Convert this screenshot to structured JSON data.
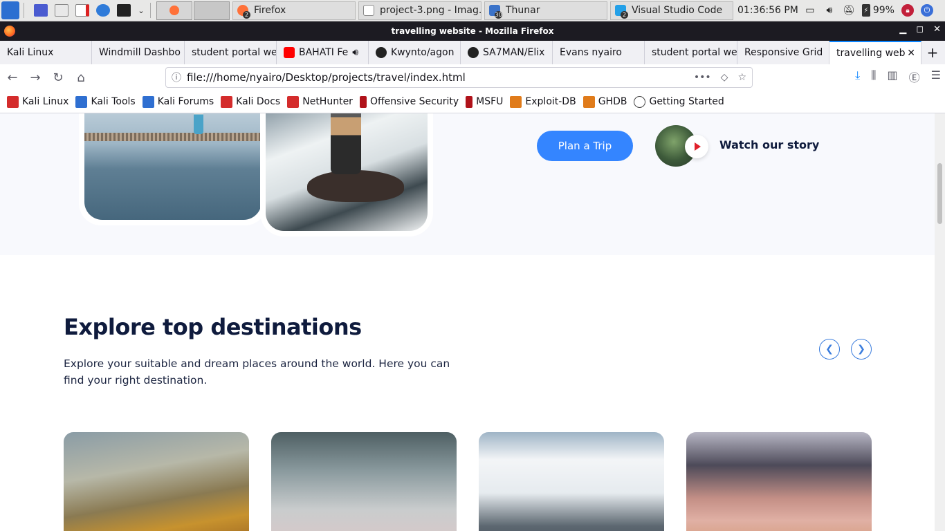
{
  "panel": {
    "tasks": [
      {
        "label": "Firefox",
        "badge": "2"
      },
      {
        "label": "project-3.png - Imag..."
      },
      {
        "label": "Thunar",
        "badge": "30"
      },
      {
        "label": "Visual Studio Code",
        "badge": "2"
      }
    ],
    "clock": "01:36:56 PM",
    "battery": "99%"
  },
  "window": {
    "title": "travelling website - Mozilla Firefox"
  },
  "tabs": [
    {
      "label": "Kali Linux"
    },
    {
      "label": "Windmill Dashbo"
    },
    {
      "label": "student portal we"
    },
    {
      "label": "BAHATI Fe"
    },
    {
      "label": "Kwynto/agon"
    },
    {
      "label": "SA7MAN/Elix"
    },
    {
      "label": "Evans nyairo"
    },
    {
      "label": "student portal we"
    },
    {
      "label": "Responsive Grid"
    },
    {
      "label": "travelling web"
    }
  ],
  "url": "file:///home/nyairo/Desktop/projects/travel/index.html",
  "bookmarks": [
    {
      "label": "Kali Linux",
      "color": "#d42c2c"
    },
    {
      "label": "Kali Tools",
      "color": "#2f6fd1"
    },
    {
      "label": "Kali Forums",
      "color": "#2f6fd1"
    },
    {
      "label": "Kali Docs",
      "color": "#d42c2c"
    },
    {
      "label": "NetHunter",
      "color": "#d42c2c"
    },
    {
      "label": "Offensive Security",
      "color": "#b0121a"
    },
    {
      "label": "MSFU",
      "color": "#b0121a"
    },
    {
      "label": "Exploit-DB",
      "color": "#e07b1a"
    },
    {
      "label": "GHDB",
      "color": "#e07b1a"
    },
    {
      "label": "Getting Started",
      "color": "#444444"
    }
  ],
  "page": {
    "plan_button": "Plan a Trip",
    "watch_story": "Watch our story",
    "explore_title": "Explore top destinations",
    "explore_desc": "Explore your suitable and dream places around the world. Here you can find your right destination.",
    "accent": "#3485ff"
  }
}
